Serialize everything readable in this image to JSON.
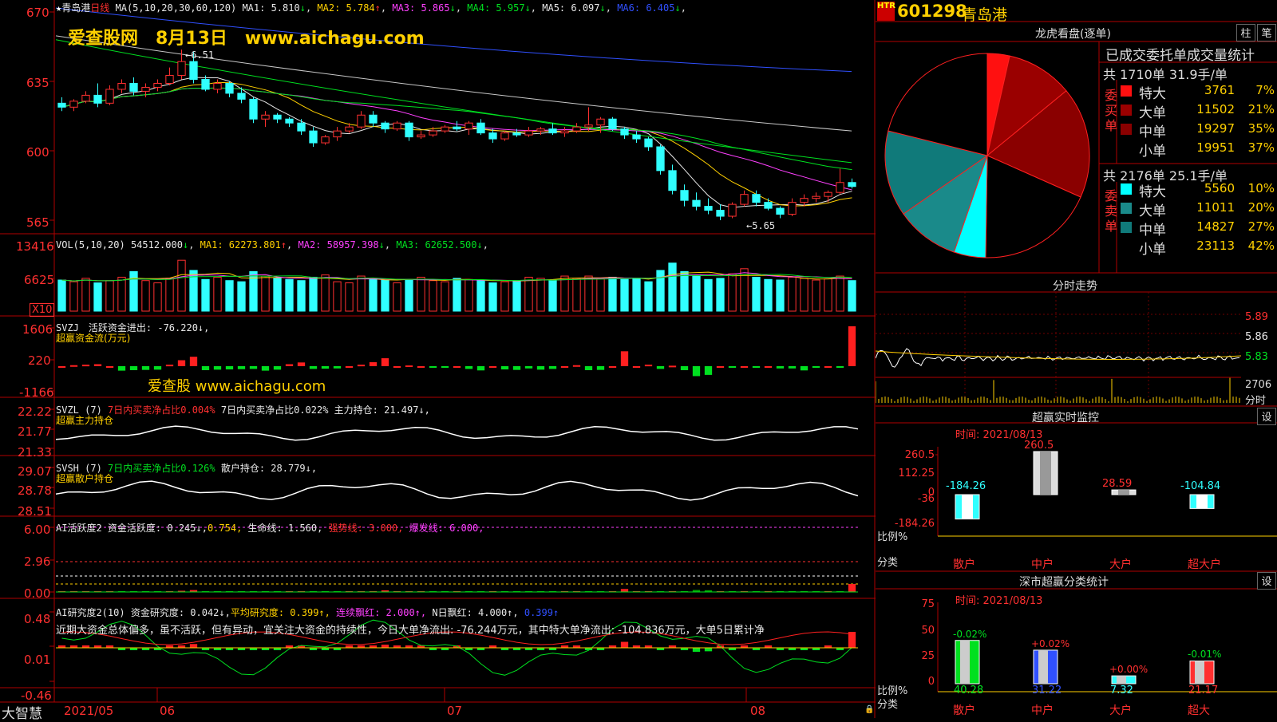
{
  "chart": {
    "stock_name": "青岛港",
    "period": "日线",
    "ma_header": "MA(5,10,20,30,60,120)",
    "ma_items": [
      {
        "label": "MA1:",
        "value": "5.810",
        "arrow": "↓",
        "color": "#e8e8e8"
      },
      {
        "label": "MA2:",
        "value": "5.784",
        "arrow": "↑",
        "color": "#ffd000"
      },
      {
        "label": "MA3:",
        "value": "5.865",
        "arrow": "↓",
        "color": "#ff40ff"
      },
      {
        "label": "MA4:",
        "value": "5.957",
        "arrow": "↓",
        "color": "#00e020"
      },
      {
        "label": "MA5:",
        "value": "6.097",
        "arrow": "↓",
        "color": "#e8e8e8"
      },
      {
        "label": "MA6:",
        "value": "6.405",
        "arrow": "↓",
        "color": "#3050ff"
      }
    ],
    "watermark_top": "爱查股网　8月13日　www.aichagu.com",
    "watermark_mid": "爱查股 www.aichagu.com",
    "price_high_label": "6.51",
    "price_low_label": "5.65",
    "price_axis": [
      "670",
      "635",
      "600",
      "565"
    ],
    "vol_header": "VOL(5,10,20)",
    "vol_value": "54512.000",
    "vol_ma_items": [
      {
        "label": "MA1:",
        "value": "62273.801",
        "arrow": "↑",
        "color": "#ffd000"
      },
      {
        "label": "MA2:",
        "value": "58957.398",
        "arrow": "↓",
        "color": "#ff40ff"
      },
      {
        "label": "MA3:",
        "value": "62652.500",
        "arrow": "↓",
        "color": "#00e020"
      }
    ],
    "vol_axis": [
      "13416",
      "6625"
    ],
    "vol_unit": "X10",
    "svzj_header": "SVZJ　活跃资金进出: -76.220↓,",
    "svzj_subtitle": "超赢资金流(万元)",
    "svzj_axis": [
      "1606",
      "220",
      "-1166"
    ],
    "svzl_header": "SVZL (7)",
    "svzl_text1": "7日内买卖净占比0.004%",
    "svzl_text2": "7日内买卖净占比0.022%",
    "svzl_text3": "主力持仓: 21.497↓,",
    "svzl_subtitle": "超赢主力持仓",
    "svzl_axis": [
      "22.22",
      "21.77",
      "21.33"
    ],
    "svsh_header": "SVSH (7)",
    "svsh_text1": "7日内买卖净占比0.126%",
    "svsh_text2": "散户持仓: 28.779↓,",
    "svsh_subtitle": "超赢散户持仓",
    "svsh_axis": [
      "29.07",
      "28.78",
      "28.51"
    ],
    "ai1_header": "AI活跃度2",
    "ai1_t1": "资金活跃度: 0.245↓,",
    "ai1_t2": "0.754,",
    "ai1_t3": "生命线: 1.560,",
    "ai1_t4": "强势线: 3.000,",
    "ai1_t5": "爆发线: 6.000,",
    "ai1_axis": [
      "6.00",
      "2.96",
      "0.00"
    ],
    "ai2_header": "AI研究度2(10)",
    "ai2_t1": "资金研究度: 0.042↓,",
    "ai2_t2": "平均研究度: 0.399↑,",
    "ai2_t3": "连续飘红: 2.000↑,",
    "ai2_t4": "N日飘红: 4.000↑,",
    "ai2_t5": "0.399↑",
    "ai2_commentary": "近期大资金总体偏多，虽不活跃，但有异动，宜关注大资金的持续性，今日大单净流出: -76.244万元，其中特大单净流出: -104.836万元，大单5日累计净",
    "ai2_axis": [
      "0.48",
      "0.01",
      "-0.46"
    ],
    "app_name": "大智慧",
    "x_labels": [
      "2021/05",
      "06",
      "07",
      "08"
    ]
  },
  "right": {
    "badge": "HTR",
    "code": "601298",
    "name": "青岛港",
    "lhb_title": "龙虎看盘(逐单)",
    "btn_zhu": "柱",
    "btn_bi": "笔",
    "stats_title": "已成交委托单成交量统计",
    "buy_total": "共 1710单 31.9手/单",
    "buy_side_label": "委买单",
    "buy_rows": [
      {
        "label": "特大",
        "value": "3761",
        "pct": "7%",
        "color": "#ff1010"
      },
      {
        "label": "大单",
        "value": "11502",
        "pct": "21%",
        "color": "#9a0000"
      },
      {
        "label": "中单",
        "value": "19297",
        "pct": "35%",
        "color": "#8a0000"
      },
      {
        "label": "小单",
        "value": "19951",
        "pct": "37%",
        "color": "#000000"
      }
    ],
    "sell_total": "共 2176单 25.1手/单",
    "sell_side_label": "委卖单",
    "sell_rows": [
      {
        "label": "特大",
        "value": "5560",
        "pct": "10%",
        "color": "#00ffff"
      },
      {
        "label": "大单",
        "value": "11011",
        "pct": "20%",
        "color": "#1a8a8a"
      },
      {
        "label": "中单",
        "value": "14827",
        "pct": "27%",
        "color": "#107a7a"
      },
      {
        "label": "小单",
        "value": "23113",
        "pct": "42%",
        "color": "#000000"
      }
    ],
    "pie_colors": [
      "#ff1010",
      "#9a0000",
      "#8a0000",
      "#000000",
      "#00ffff",
      "#1a8a8a",
      "#107a7a",
      "#000000"
    ],
    "pie_values": [
      7,
      21,
      35,
      37,
      10,
      20,
      27,
      42
    ],
    "intraday_title": "分时走势",
    "intraday_axis": [
      "5.89",
      "5.86",
      "5.83",
      "2706"
    ],
    "intraday_unit": "分时",
    "monitor_title": "超赢实时监控",
    "monitor_btn": "设",
    "monitor_time": "时间: 2021/08/13",
    "monitor_axis": [
      "260.5",
      "112.25",
      "0",
      "-36",
      "-184.26"
    ],
    "monitor_bars": [
      {
        "cat": "散户",
        "label": "-184.26",
        "value": -184.26
      },
      {
        "cat": "中户",
        "label": "260.5",
        "value": 260.5
      },
      {
        "cat": "大户",
        "label": "28.59",
        "value": 28.59
      },
      {
        "cat": "超大户",
        "label": "-104.84",
        "value": -104.84
      }
    ],
    "ratio_label": "比例%",
    "cat_label": "分类",
    "sz_title": "深市超赢分类统计",
    "sz_btn": "设",
    "sz_time": "时间: 2021/08/13",
    "sz_axis": [
      "75",
      "50",
      "25",
      "0"
    ],
    "sz_bars": [
      {
        "cat": "散户",
        "label": "-0.02%",
        "value": 40.28,
        "bottom": "40.28",
        "color": "#00e020"
      },
      {
        "cat": "中户",
        "label": "+0.02%",
        "value": 31.22,
        "bottom": "31.22",
        "color": "#3050ff"
      },
      {
        "cat": "大户",
        "label": "+0.00%",
        "value": 7.32,
        "bottom": "7.32",
        "color": "#30ffff"
      },
      {
        "cat": "超大",
        "label": "-0.01%",
        "value": 21.17,
        "bottom": "21.17",
        "color": "#ff3030"
      }
    ]
  },
  "chart_data": {
    "type": "candlestick",
    "title": "青岛港 日线",
    "ylim": [
      5.5,
      6.8
    ],
    "date_range": [
      "2021/05",
      "2021/08/13"
    ],
    "ohlc": [
      [
        6.24,
        6.27,
        6.2,
        6.22
      ],
      [
        6.22,
        6.26,
        6.2,
        6.25
      ],
      [
        6.25,
        6.3,
        6.24,
        6.28
      ],
      [
        6.28,
        6.34,
        6.22,
        6.24
      ],
      [
        6.24,
        6.33,
        6.23,
        6.31
      ],
      [
        6.31,
        6.36,
        6.29,
        6.34
      ],
      [
        6.34,
        6.37,
        6.28,
        6.3
      ],
      [
        6.3,
        6.34,
        6.27,
        6.32
      ],
      [
        6.32,
        6.36,
        6.3,
        6.34
      ],
      [
        6.34,
        6.42,
        6.33,
        6.38
      ],
      [
        6.38,
        6.51,
        6.36,
        6.45
      ],
      [
        6.45,
        6.5,
        6.34,
        6.36
      ],
      [
        6.36,
        6.38,
        6.3,
        6.31
      ],
      [
        6.31,
        6.36,
        6.29,
        6.34
      ],
      [
        6.34,
        6.35,
        6.27,
        6.29
      ],
      [
        6.29,
        6.32,
        6.24,
        6.26
      ],
      [
        6.26,
        6.27,
        6.14,
        6.16
      ],
      [
        6.16,
        6.2,
        6.12,
        6.18
      ],
      [
        6.18,
        6.19,
        6.14,
        6.16
      ],
      [
        6.16,
        6.17,
        6.12,
        6.14
      ],
      [
        6.14,
        6.16,
        6.08,
        6.1
      ],
      [
        6.1,
        6.12,
        6.02,
        6.04
      ],
      [
        6.04,
        6.08,
        6.03,
        6.07
      ],
      [
        6.07,
        6.12,
        6.05,
        6.1
      ],
      [
        6.1,
        6.14,
        6.09,
        6.12
      ],
      [
        6.12,
        6.2,
        6.11,
        6.18
      ],
      [
        6.18,
        6.2,
        6.12,
        6.14
      ],
      [
        6.14,
        6.15,
        6.09,
        6.11
      ],
      [
        6.11,
        6.15,
        6.1,
        6.14
      ],
      [
        6.14,
        6.15,
        6.05,
        6.07
      ],
      [
        6.07,
        6.1,
        6.06,
        6.08
      ],
      [
        6.08,
        6.12,
        6.07,
        6.1
      ],
      [
        6.1,
        6.13,
        6.09,
        6.12
      ],
      [
        6.12,
        6.15,
        6.1,
        6.11
      ],
      [
        6.11,
        6.15,
        6.08,
        6.14
      ],
      [
        6.14,
        6.16,
        6.08,
        6.09
      ],
      [
        6.09,
        6.11,
        6.04,
        6.06
      ],
      [
        6.06,
        6.1,
        6.05,
        6.09
      ],
      [
        6.09,
        6.11,
        6.07,
        6.08
      ],
      [
        6.08,
        6.12,
        6.07,
        6.1
      ],
      [
        6.1,
        6.12,
        6.08,
        6.11
      ],
      [
        6.11,
        6.14,
        6.08,
        6.09
      ],
      [
        6.09,
        6.12,
        6.07,
        6.1
      ],
      [
        6.1,
        6.14,
        6.09,
        6.12
      ],
      [
        6.12,
        6.22,
        6.1,
        6.13
      ],
      [
        6.13,
        6.17,
        6.09,
        6.16
      ],
      [
        6.16,
        6.17,
        6.1,
        6.11
      ],
      [
        6.11,
        6.12,
        6.06,
        6.08
      ],
      [
        6.08,
        6.1,
        6.04,
        6.06
      ],
      [
        6.06,
        6.07,
        6.0,
        6.02
      ],
      [
        6.02,
        6.03,
        5.88,
        5.9
      ],
      [
        5.9,
        5.93,
        5.78,
        5.8
      ],
      [
        5.8,
        5.83,
        5.72,
        5.75
      ],
      [
        5.75,
        5.79,
        5.7,
        5.72
      ],
      [
        5.72,
        5.76,
        5.68,
        5.7
      ],
      [
        5.7,
        5.73,
        5.65,
        5.67
      ],
      [
        5.67,
        5.74,
        5.66,
        5.73
      ],
      [
        5.73,
        5.8,
        5.72,
        5.78
      ],
      [
        5.78,
        5.8,
        5.72,
        5.74
      ],
      [
        5.74,
        5.76,
        5.7,
        5.71
      ],
      [
        5.71,
        5.72,
        5.66,
        5.68
      ],
      [
        5.68,
        5.76,
        5.67,
        5.74
      ],
      [
        5.74,
        5.78,
        5.72,
        5.76
      ],
      [
        5.76,
        5.79,
        5.74,
        5.77
      ],
      [
        5.77,
        5.8,
        5.74,
        5.79
      ],
      [
        5.79,
        5.91,
        5.78,
        5.84
      ],
      [
        5.84,
        5.86,
        5.81,
        5.82
      ]
    ],
    "volume": [
      55,
      52,
      58,
      50,
      54,
      60,
      70,
      54,
      50,
      58,
      90,
      72,
      56,
      60,
      54,
      52,
      70,
      62,
      58,
      56,
      54,
      60,
      64,
      52,
      50,
      62,
      58,
      55,
      50,
      56,
      60,
      54,
      52,
      58,
      56,
      54,
      50,
      52,
      54,
      60,
      58,
      55,
      62,
      58,
      62,
      57,
      60,
      56,
      58,
      52,
      72,
      85,
      70,
      62,
      56,
      58,
      66,
      75,
      60,
      56,
      55,
      60,
      58,
      55,
      57,
      62,
      54
    ],
    "svzj": [
      0,
      40,
      60,
      80,
      0,
      -180,
      -160,
      -150,
      -140,
      60,
      240,
      380,
      -160,
      -140,
      -130,
      -120,
      -110,
      -180,
      -140,
      80,
      150,
      -110,
      -100,
      -90,
      0,
      60,
      160,
      320,
      0,
      30,
      0,
      -20,
      -50,
      0,
      -110,
      -170,
      0,
      -130,
      -150,
      -90,
      -140,
      -110,
      0,
      40,
      -160,
      -150,
      0,
      600,
      0,
      60,
      -110,
      20,
      -160,
      -400,
      -350,
      0,
      -30,
      0,
      -30,
      0,
      -90,
      -90,
      -170,
      -50,
      0,
      -40,
      1606,
      -20
    ]
  }
}
